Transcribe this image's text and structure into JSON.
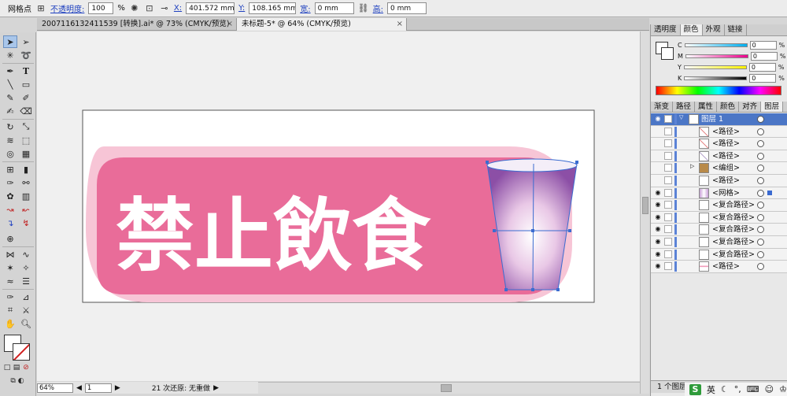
{
  "control_bar": {
    "tool_name": "网格点",
    "opacity_label": "不透明度:",
    "opacity_value": "100",
    "percent": "%",
    "x_label": "X:",
    "x_value": "401.572 mm",
    "y_label": "Y:",
    "y_value": "108.165 mm",
    "w_label": "宽:",
    "w_value": "0 mm",
    "h_label": "高:",
    "h_value": "0 mm"
  },
  "doc_tabs": [
    {
      "label": "2007116132411539 [转换].ai* @ 73% (CMYK/预览)"
    },
    {
      "label": "未标题-5* @ 64% (CMYK/预览)"
    }
  ],
  "artwork": {
    "text": "禁止飲食",
    "colors": {
      "pink": "#e96c99",
      "light_pink": "#f7c5d6",
      "cup_purple": "#9b5fb0"
    }
  },
  "status_bar": {
    "zoom": "64%",
    "page": "1",
    "message": "21 次还原: 无重做"
  },
  "right_panel": {
    "top_tabs": [
      "透明度",
      "颜色",
      "外观",
      "链接"
    ],
    "sliders": [
      {
        "channel": "C",
        "value": "0",
        "unit": "%"
      },
      {
        "channel": "M",
        "value": "0",
        "unit": "%"
      },
      {
        "channel": "Y",
        "value": "0",
        "unit": "%"
      },
      {
        "channel": "K",
        "value": "0",
        "unit": "%"
      }
    ],
    "layer_tabs": [
      "渐变",
      "路径",
      "属性",
      "颜色",
      "对齐",
      "图层"
    ],
    "layers": [
      {
        "name": "图层 1",
        "top": true
      },
      {
        "name": "<路径>"
      },
      {
        "name": "<路径>"
      },
      {
        "name": "<路径>"
      },
      {
        "name": "<编组>",
        "group": true
      },
      {
        "name": "<路径>"
      },
      {
        "name": "<网格>",
        "selected": true
      },
      {
        "name": "<复合路径>"
      },
      {
        "name": "<复合路径>"
      },
      {
        "name": "<复合路径>"
      },
      {
        "name": "<复合路径>"
      },
      {
        "name": "<复合路径>"
      },
      {
        "name": "<路径>"
      }
    ],
    "footer": "1 个图层"
  },
  "tray": {
    "ime": "英"
  }
}
